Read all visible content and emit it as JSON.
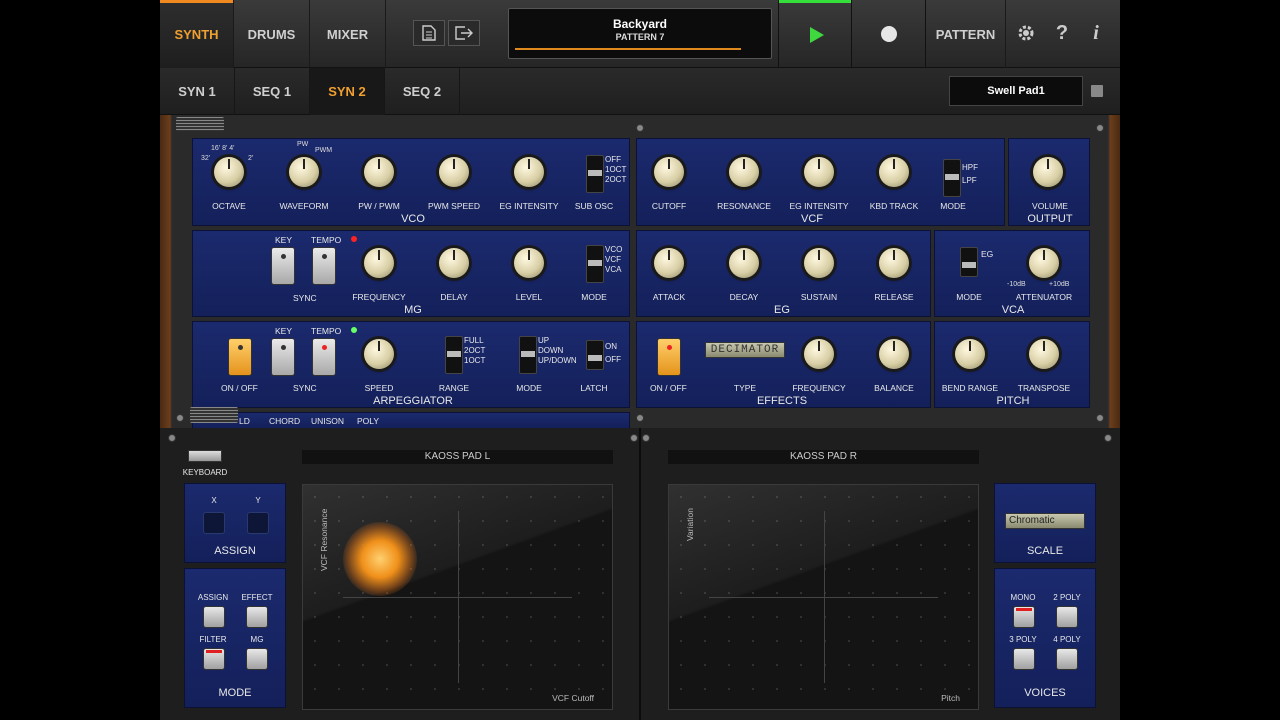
{
  "topbar": {
    "tabs": [
      "SYNTH",
      "DRUMS",
      "MIXER"
    ],
    "display_title": "Backyard",
    "display_subtitle": "PATTERN 7",
    "pattern_label": "PATTERN"
  },
  "subbar": {
    "tabs": [
      "SYN 1",
      "SEQ 1",
      "SYN 2",
      "SEQ 2"
    ],
    "preset_name": "Swell Pad1"
  },
  "vco": {
    "title": "VCO",
    "octave": "OCTAVE",
    "waveform": "WAVEFORM",
    "pw_pwm": "PW / PWM",
    "pwm_speed": "PWM SPEED",
    "eg_intensity": "EG INTENSITY",
    "sub_osc": "SUB OSC",
    "sub_osc_options": [
      "OFF",
      "1OCT",
      "2OCT"
    ],
    "octave_ticks": [
      "16'",
      "8'",
      "4'",
      "32'",
      "2'"
    ],
    "wave_ticks": [
      "PW",
      "PWM"
    ]
  },
  "vcf": {
    "title": "VCF",
    "cutoff": "CUTOFF",
    "resonance": "RESONANCE",
    "eg_intensity": "EG INTENSITY",
    "kbd_track": "KBD TRACK",
    "mode": "MODE",
    "mode_options": [
      "HPF",
      "LPF"
    ]
  },
  "output": {
    "title": "OUTPUT",
    "volume": "VOLUME"
  },
  "mg": {
    "title": "MG",
    "key": "KEY",
    "tempo": "TEMPO",
    "sync": "SYNC",
    "frequency": "FREQUENCY",
    "delay": "DELAY",
    "level": "LEVEL",
    "mode": "MODE",
    "mode_options": [
      "VCO",
      "VCF",
      "VCA"
    ]
  },
  "eg": {
    "title": "EG",
    "attack": "ATTACK",
    "decay": "DECAY",
    "sustain": "SUSTAIN",
    "release": "RELEASE"
  },
  "vca": {
    "title": "VCA",
    "mode": "MODE",
    "attenuator": "ATTENUATOR",
    "eg": "EG",
    "range_lo": "-10dB",
    "range_hi": "+10dB"
  },
  "arpeggiator": {
    "title": "ARPEGGIATOR",
    "on_off": "ON / OFF",
    "key": "KEY",
    "tempo": "TEMPO",
    "sync": "SYNC",
    "speed": "SPEED",
    "range": "RANGE",
    "range_options": [
      "FULL",
      "2OCT",
      "1OCT"
    ],
    "mode": "MODE",
    "mode_options": [
      "UP",
      "DOWN",
      "UP/DOWN"
    ],
    "latch": "LATCH",
    "latch_options": [
      "ON",
      "OFF"
    ]
  },
  "effects": {
    "title": "EFFECTS",
    "on_off": "ON / OFF",
    "type": "TYPE",
    "type_value": "DECIMATOR",
    "frequency": "FREQUENCY",
    "balance": "BALANCE"
  },
  "pitch": {
    "title": "PITCH",
    "bend_range": "BEND RANGE",
    "transpose": "TRANSPOSE"
  },
  "lower_strip": [
    "LD",
    "CHORD",
    "UNISON",
    "POLY"
  ],
  "keyboard_label": "KEYBOARD",
  "assign": {
    "title": "ASSIGN",
    "x": "X",
    "y": "Y"
  },
  "mode_box": {
    "title": "MODE",
    "assign": "ASSIGN",
    "effect": "EFFECT",
    "filter": "FILTER",
    "mg": "MG"
  },
  "kaoss_l": {
    "title": "KAOSS PAD L",
    "x_label": "VCF Cutoff",
    "y_label": "VCF Resonance"
  },
  "kaoss_r": {
    "title": "KAOSS PAD R",
    "x_label": "Pitch",
    "y_label": "Variation"
  },
  "scale": {
    "title": "SCALE",
    "value": "Chromatic"
  },
  "voices": {
    "title": "VOICES",
    "mono": "MONO",
    "poly2": "2 POLY",
    "poly3": "3 POLY",
    "poly4": "4 POLY"
  },
  "icons": [
    "document-icon",
    "export-icon",
    "play-icon",
    "record-icon",
    "gear-icon",
    "help-icon",
    "info-icon",
    "save-icon"
  ]
}
